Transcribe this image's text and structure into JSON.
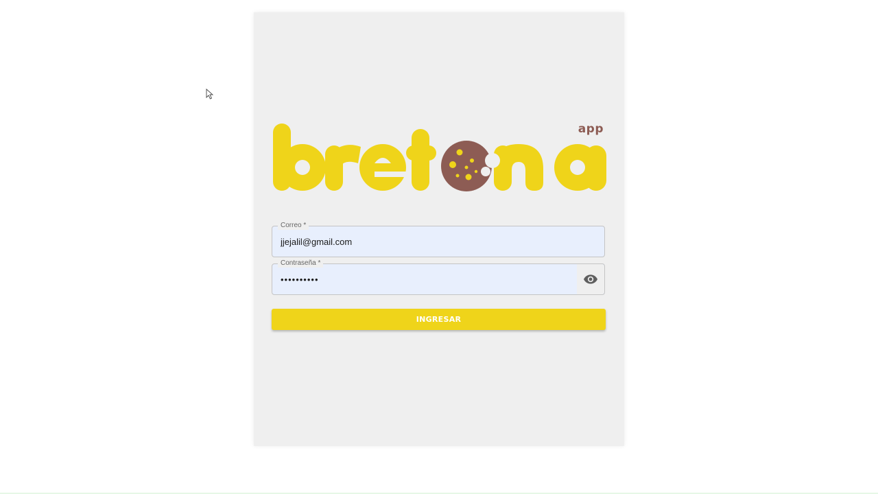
{
  "logo": {
    "brand_text": "bretona",
    "badge": "app",
    "colors": {
      "brand_yellow": "#efd41a",
      "cookie_brown": "#8d5c54"
    }
  },
  "form": {
    "email": {
      "label": "Correo *",
      "value": "jjejalil@gmail.com"
    },
    "password": {
      "label": "Contraseña *",
      "value": "••••••••••",
      "toggle_icon": "eye-icon"
    },
    "submit_label": "INGRESAR"
  },
  "colors": {
    "accent": "#efd41a",
    "card_background": "#efefef",
    "field_background": "#e8effd"
  }
}
